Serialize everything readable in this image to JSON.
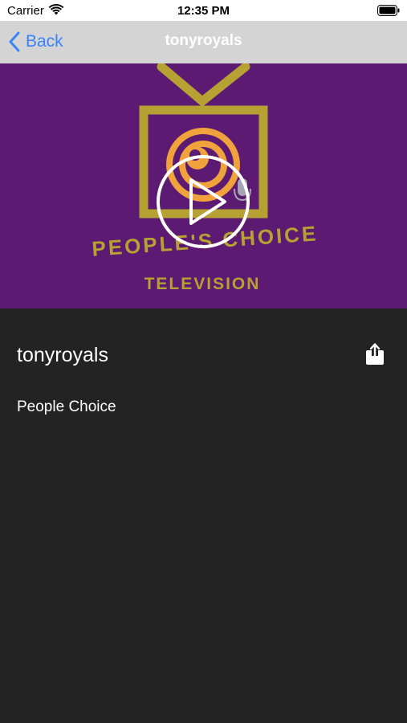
{
  "status_bar": {
    "carrier": "Carrier",
    "time": "12:35 PM",
    "wifi_icon": "wifi-icon",
    "battery_icon": "battery-icon"
  },
  "nav": {
    "back_label": "Back",
    "title": "tonyroyals",
    "accent_color": "#3b82f6"
  },
  "video": {
    "logo_line1": "PEOPLE'S CHOICE",
    "logo_line2": "TELEVISION",
    "background_color": "#5c1a72",
    "play_icon": "play-icon"
  },
  "detail": {
    "title": "tonyroyals",
    "description": "People Choice",
    "share_icon": "share-icon"
  }
}
